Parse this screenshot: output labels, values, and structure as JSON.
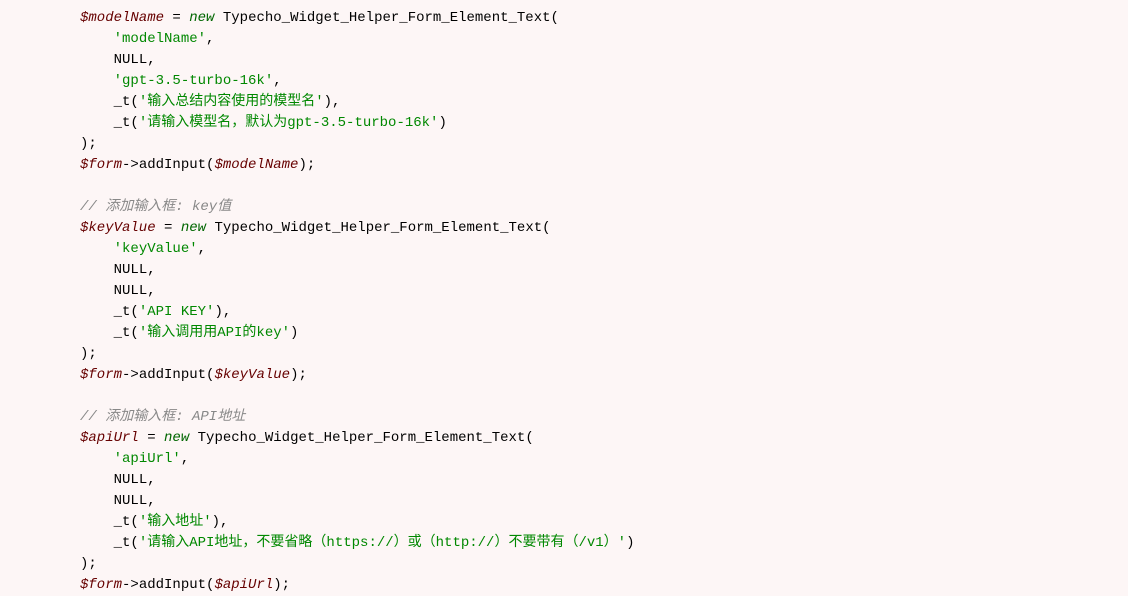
{
  "code": {
    "block1": {
      "var": "$modelName",
      "new": "new",
      "class": "Typecho_Widget_Helper_Form_Element_Text",
      "arg1": "'modelName'",
      "arg2": "NULL",
      "arg3": "'gpt-3.5-turbo-16k'",
      "arg4_fn": "_t",
      "arg4_str": "'输入总结内容使用的模型名'",
      "arg5_fn": "_t",
      "arg5_str": "'请输入模型名，默认为gpt-3.5-turbo-16k'",
      "formVar": "$form",
      "formMethod": "->addInput("
    },
    "block2": {
      "comment": "// 添加输入框: key值",
      "var": "$keyValue",
      "new": "new",
      "class": "Typecho_Widget_Helper_Form_Element_Text",
      "arg1": "'keyValue'",
      "arg2": "NULL",
      "arg3": "NULL",
      "arg4_fn": "_t",
      "arg4_str": "'API KEY'",
      "arg5_fn": "_t",
      "arg5_str": "'输入调用用API的key'",
      "formVar": "$form",
      "formMethod": "->addInput("
    },
    "block3": {
      "comment": "// 添加输入框: API地址",
      "var": "$apiUrl",
      "new": "new",
      "class": "Typecho_Widget_Helper_Form_Element_Text",
      "arg1": "'apiUrl'",
      "arg2": "NULL",
      "arg3": "NULL",
      "arg4_fn": "_t",
      "arg4_str": "'输入地址'",
      "arg5_fn": "_t",
      "arg5_str": "'请输入API地址，不要省略（https://）或（http://）不要带有（/v1）'",
      "formVar": "$form",
      "formMethod": "->addInput("
    }
  }
}
